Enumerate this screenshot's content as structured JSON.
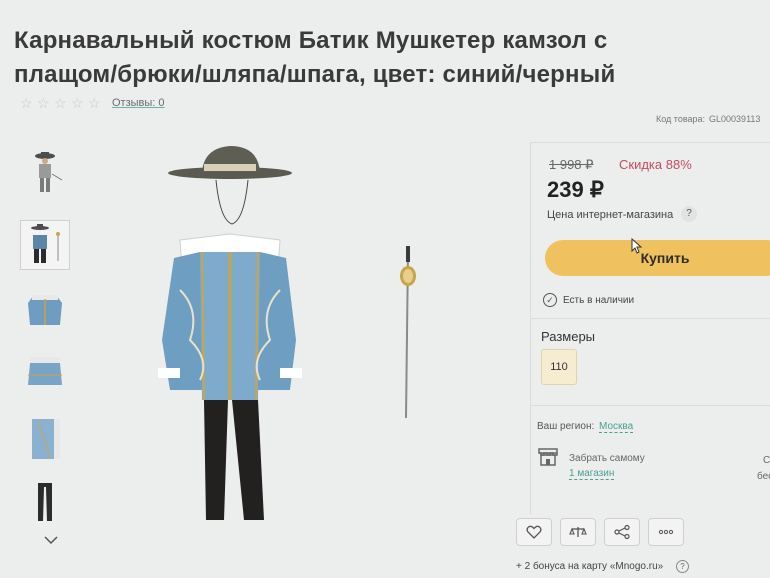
{
  "product": {
    "title_line1": "Карнавальный костюм Батик Мушкетер камзол с",
    "title_line2": "плащом/брюки/шляпа/шпага, цвет: синий/черный",
    "rating_stars": 0,
    "reviews_label": "Отзывы: 0",
    "sku_label": "Код товара:",
    "sku_value": "GL00039113"
  },
  "gallery": {
    "thumbnails": [
      "musketeer-full-icon",
      "musketeer-set-icon",
      "jacket-front-icon",
      "jacket-back-icon",
      "sleeve-detail-icon",
      "trousers-icon"
    ],
    "active_index": 1,
    "down_arrow": "chevron-down-icon"
  },
  "pricing": {
    "old_price": "1 998 ₽",
    "discount": "Скидка 88%",
    "price": "239 ₽",
    "price_note": "Цена интернет-магазина",
    "help": "?",
    "buy_label": "Купить",
    "stock_text": "Есть в наличии",
    "check_symbol": "✓"
  },
  "sizes": {
    "title": "Размеры",
    "options": [
      "110"
    ]
  },
  "delivery": {
    "region_label": "Ваш регион:",
    "region_value": "Москва",
    "pickup_label": "Забрать самому",
    "pickup_stores": "1 магазин",
    "edge_c": "С",
    "edge_b": "бесп"
  },
  "actions": [
    "heart-icon",
    "compare-icon",
    "share-icon",
    "more-icon"
  ],
  "bonus": {
    "text": "+ 2 бонуса на карту «Mnogo.ru»",
    "help": "?"
  },
  "colors": {
    "accent_button": "#f0c25f",
    "discount": "#c64a62",
    "link": "#4a9f92"
  }
}
